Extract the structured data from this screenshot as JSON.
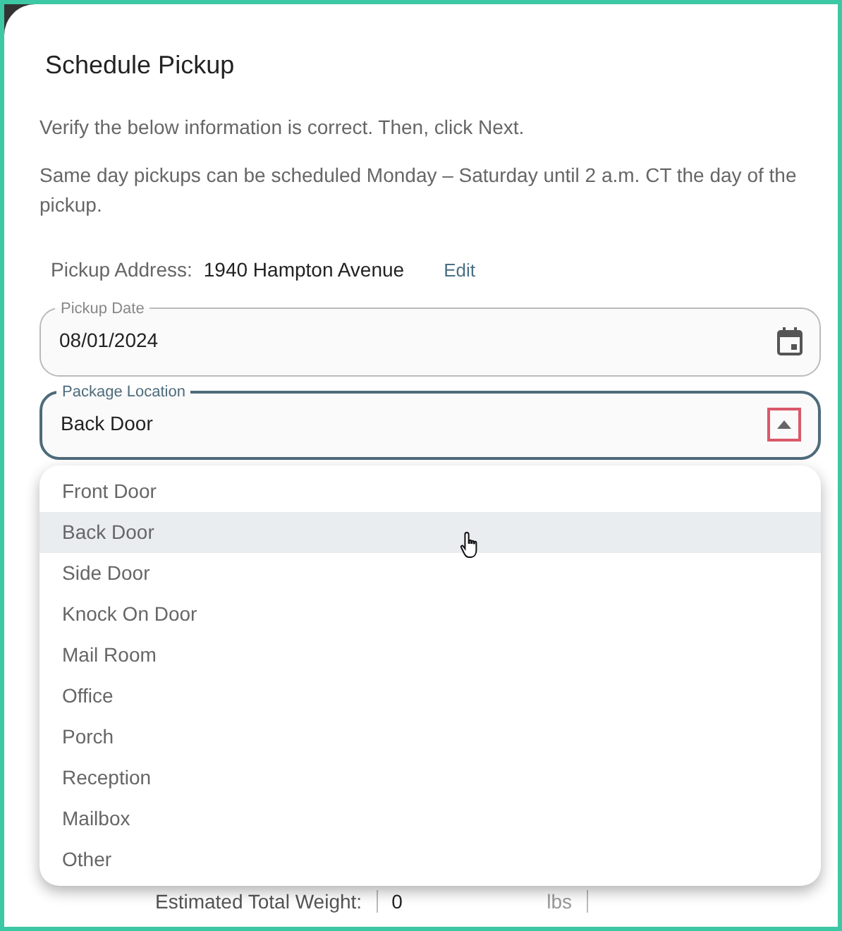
{
  "dialog": {
    "title": "Schedule Pickup",
    "intro": "Verify the below information is correct. Then, click Next.",
    "note": "Same day pickups can be scheduled Monday – Saturday until 2 a.m. CT the day of the pickup.",
    "address": {
      "label": "Pickup Address:",
      "value": "1940 Hampton Avenue",
      "link": "Edit"
    },
    "pickup_date": {
      "label": "Pickup Date",
      "value": "08/01/2024"
    },
    "package_location": {
      "label": "Package Location",
      "value": "Back Door",
      "expanded": true,
      "options": [
        {
          "label": "Front Door",
          "selected": false
        },
        {
          "label": "Back Door",
          "selected": true
        },
        {
          "label": "Side Door",
          "selected": false
        },
        {
          "label": "Knock On Door",
          "selected": false
        },
        {
          "label": "Mail Room",
          "selected": false
        },
        {
          "label": "Office",
          "selected": false
        },
        {
          "label": "Porch",
          "selected": false
        },
        {
          "label": "Reception",
          "selected": false
        },
        {
          "label": "Mailbox",
          "selected": false
        },
        {
          "label": "Other",
          "selected": false
        }
      ]
    },
    "weight": {
      "label": "Estimated Total Weight:",
      "value": "0",
      "unit": "lbs"
    }
  }
}
